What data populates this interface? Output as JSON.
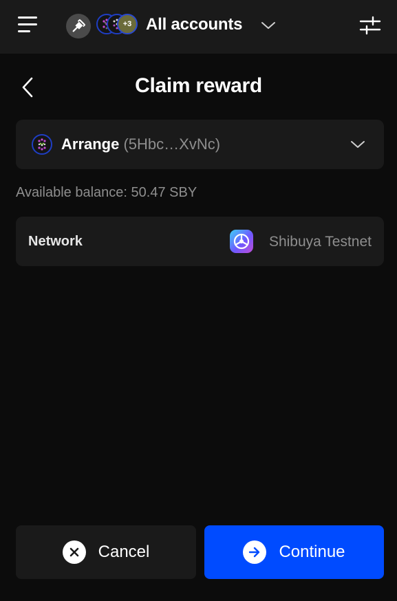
{
  "header": {
    "title": "All accounts",
    "more_accounts_badge": "+3",
    "icons": {
      "menu": "hamburger-menu-icon",
      "connect": "plug-icon",
      "dropdown": "chevron-down-icon",
      "settings": "sliders-icon"
    }
  },
  "page": {
    "title": "Claim reward",
    "back_icon": "chevron-left-icon"
  },
  "account_selector": {
    "name": "Arrange",
    "address": "(5Hbc…XvNc)",
    "dropdown_icon": "chevron-down-icon"
  },
  "balance": {
    "text": "Available balance: 50.47 SBY"
  },
  "network": {
    "label": "Network",
    "value": "Shibuya Testnet",
    "icon": "shibuya-network-icon"
  },
  "actions": {
    "cancel_label": "Cancel",
    "continue_label": "Continue"
  },
  "colors": {
    "background": "#0c0c0c",
    "surface": "#1a1a1a",
    "primary": "#004bff",
    "muted_text": "#8e8e8e"
  }
}
